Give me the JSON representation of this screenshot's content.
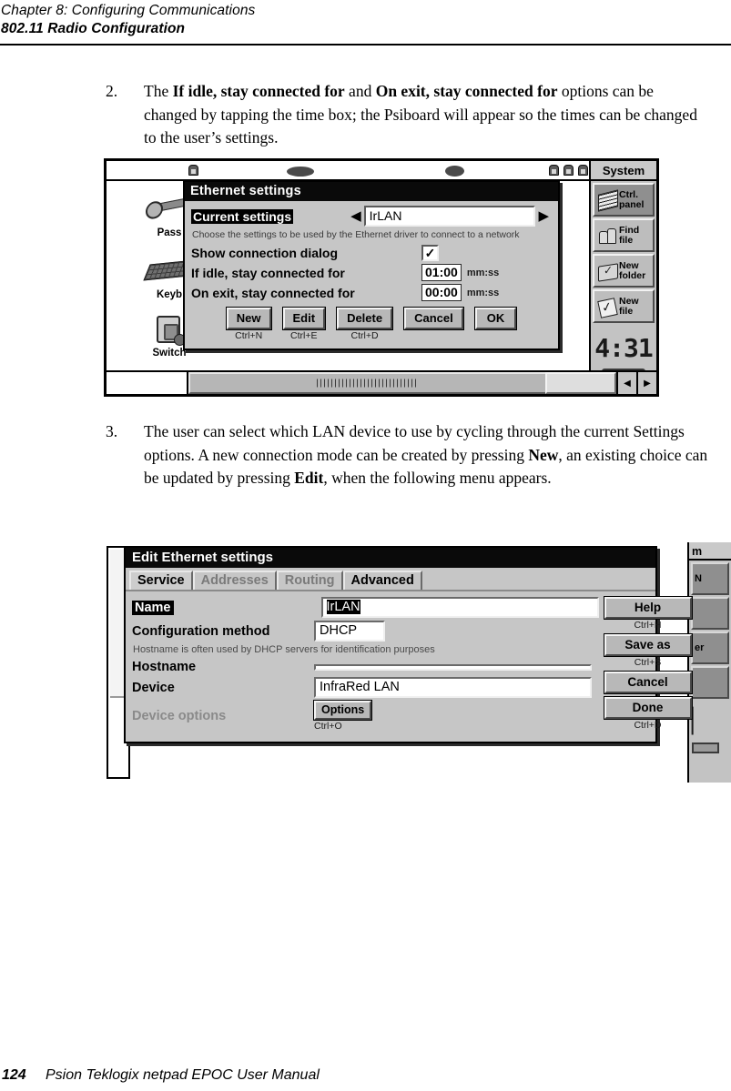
{
  "runhead": {
    "chapter": "Chapter 8:  Configuring Communications",
    "section": "802.11 Radio Configuration"
  },
  "steps": [
    {
      "number": "2.",
      "parts": [
        {
          "t": "The ",
          "b": false
        },
        {
          "t": "If idle, stay connected for",
          "b": true
        },
        {
          "t": " and ",
          "b": false
        },
        {
          "t": "On exit, stay connected for",
          "b": true
        },
        {
          "t": " options can be changed by tapping the time box; the Psiboard will appear so the times can be changed to the user’s settings.",
          "b": false
        }
      ]
    },
    {
      "number": "3.",
      "parts": [
        {
          "t": "The user can select which LAN device to use by cycling through the current Settings options. A new connection mode can be created by pressing ",
          "b": false
        },
        {
          "t": "New",
          "b": true
        },
        {
          "t": ", an existing choice can be updated by pressing ",
          "b": false
        },
        {
          "t": "Edit",
          "b": true
        },
        {
          "t": ", when the following menu appears.",
          "b": false
        }
      ]
    }
  ],
  "shot1": {
    "desktop_icons": [
      {
        "label": "Pass",
        "icon": "key-icon"
      },
      {
        "label": "Keyb",
        "icon": "keyboard-icon"
      },
      {
        "label": "Switch",
        "icon": "switch-device-icon"
      }
    ],
    "sysbar": {
      "title": "System",
      "buttons": [
        {
          "label": "Ctrl.\npanel",
          "icon": "control-panel-icon",
          "selected": true
        },
        {
          "label": "Find\nfile",
          "icon": "find-file-icon",
          "selected": false
        },
        {
          "label": "New\nfolder",
          "icon": "new-folder-icon",
          "selected": false
        },
        {
          "label": "New\nfile",
          "icon": "new-file-icon",
          "selected": false
        }
      ],
      "clock": "4:31"
    },
    "dialog": {
      "title": "Ethernet settings",
      "current_settings_label": "Current settings",
      "current_settings_value": "IrLAN",
      "arrow_prev": "◀",
      "arrow_next": "▶",
      "hint": "Choose the settings to be used by the Ethernet driver to connect to a network",
      "show_dialog_label": "Show connection dialog",
      "show_dialog_checked": "✓",
      "idle_label": "If idle, stay connected for",
      "idle_value": "01:00",
      "idle_unit": "mm:ss",
      "exit_label": "On exit, stay connected for",
      "exit_value": "00:00",
      "exit_unit": "mm:ss",
      "buttons": [
        {
          "label": "New",
          "shortcut": "Ctrl+N"
        },
        {
          "label": "Edit",
          "shortcut": "Ctrl+E"
        },
        {
          "label": "Delete",
          "shortcut": "Ctrl+D"
        },
        {
          "label": "Cancel",
          "shortcut": ""
        },
        {
          "label": "OK",
          "shortcut": ""
        }
      ]
    }
  },
  "shot2": {
    "background_sysbar": {
      "title": "m",
      "buttons": [
        "N",
        "",
        "er",
        ""
      ],
      "clock": "▏"
    },
    "dialog": {
      "title": "Edit Ethernet settings",
      "tabs": [
        {
          "label": "Service",
          "state": "active"
        },
        {
          "label": "Addresses",
          "state": "dimmed"
        },
        {
          "label": "Routing",
          "state": "dimmed"
        },
        {
          "label": "Advanced",
          "state": "normal"
        }
      ],
      "fields": [
        {
          "label": "Name",
          "value": "IrLAN",
          "label_selected": true,
          "value_selected": true,
          "input": "long"
        },
        {
          "label": "Configuration method",
          "value": "DHCP",
          "label_selected": false,
          "value_selected": false,
          "input": "short"
        },
        {
          "label": "Hostname",
          "value": "",
          "label_selected": false,
          "value_selected": false,
          "input": "long"
        },
        {
          "label": "Device",
          "value": "InfraRed LAN",
          "label_selected": false,
          "value_selected": false,
          "input": "long"
        }
      ],
      "hostname_hint": "Hostname is often used by DHCP servers for identification purposes",
      "device_options_label": "Device options",
      "device_options_button": "Options",
      "device_options_shortcut": "Ctrl+O",
      "side_buttons": [
        {
          "label": "Help",
          "shortcut": "Ctrl+H"
        },
        {
          "label": "Save as",
          "shortcut": "Ctrl+S"
        },
        {
          "label": "Cancel",
          "shortcut": ""
        },
        {
          "label": "Done",
          "shortcut": "Ctrl+D"
        }
      ]
    }
  },
  "footer": {
    "page": "124",
    "text": "Psion Teklogix netpad EPOC User Manual"
  }
}
